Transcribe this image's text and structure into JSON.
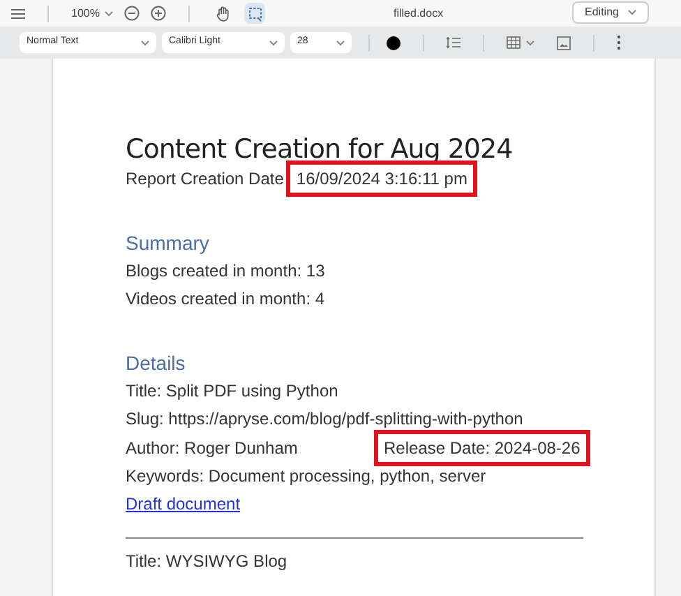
{
  "top_bar": {
    "zoom": "100%",
    "file_name": "filled.docx",
    "mode": "Editing",
    "tools": [
      {
        "kind": "pan",
        "selected": false
      },
      {
        "kind": "select",
        "selected": true
      }
    ]
  },
  "format_bar": {
    "style": "Normal Text",
    "font": "Calibri Light",
    "size": "28",
    "color": "#000000"
  },
  "document": {
    "title": "Content Creation for Aug 2024",
    "report_line": {
      "label": "Report Creation Date",
      "value": "16/09/2024 3:16:11 pm",
      "highlighted": true
    },
    "sections": [
      {
        "heading": "Summary",
        "lines": [
          {
            "kind": "text",
            "text": "Blogs created in month: 13"
          },
          {
            "kind": "text",
            "text": "Videos created in month: 4"
          }
        ]
      },
      {
        "heading": "Details",
        "lines": [
          {
            "kind": "text",
            "text": "Title: Split PDF using Python"
          },
          {
            "kind": "text",
            "text": "Slug: https://apryse.com/blog/pdf-splitting-with-python"
          },
          {
            "kind": "pair",
            "text": "Author: Roger Dunham",
            "side": "Release Date: 2024-08-26",
            "highlighted": true
          },
          {
            "kind": "text",
            "text": "Keywords: Document processing, python, server"
          },
          {
            "kind": "link",
            "text": "Draft document"
          },
          {
            "kind": "rule"
          },
          {
            "kind": "text",
            "text": "Title: WYSIWYG Blog"
          }
        ]
      }
    ]
  }
}
